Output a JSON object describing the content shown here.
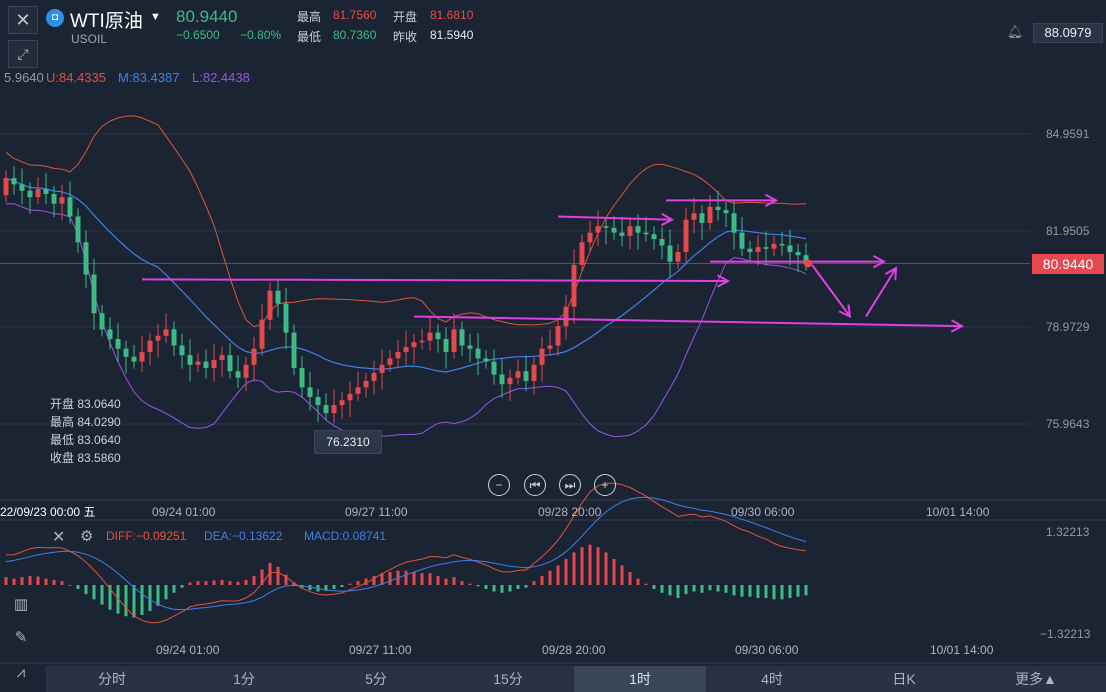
{
  "header": {
    "close_icon": "close-icon",
    "symbol_name": "WTI原油",
    "symbol_code": "USOIL",
    "last_price": "80.9440",
    "change": "−0.6500",
    "change_pct": "−0.80%",
    "high_label": "最高",
    "high_value": "81.7560",
    "open_label": "开盘",
    "open_value": "81.6810",
    "low_label": "最低",
    "low_value": "80.7360",
    "prev_close_label": "昨收",
    "prev_close_value": "81.5940",
    "alert_value": "88.0979"
  },
  "indicators": {
    "bb_cut": "5.9640",
    "bb_u": "U:84.4335",
    "bb_m": "M:83.4387",
    "bb_l": "L:82.4438",
    "macd_diff": "DIFF:−0.09251",
    "macd_dea": "DEA:−0.13622",
    "macd_macd": "MACD:0.08741"
  },
  "ohlc_box": {
    "open": "开盘 83.0640",
    "high": "最高 84.0290",
    "low": "最低 83.0640",
    "close": "收盘 83.5860"
  },
  "price_axis": [
    "84.9591",
    "81.9505",
    "78.9729",
    "75.9643"
  ],
  "current_price_tag": "80.9440",
  "low_marker": "76.2310",
  "start_time": "22/09/23 00:00 五",
  "time_axis_main": [
    "09/24 01:00",
    "09/27 11:00",
    "09/28 20:00",
    "09/30 06:00",
    "10/01 14:00"
  ],
  "time_axis_macd": [
    "09/24 01:00",
    "09/27 11:00",
    "09/28 20:00",
    "09/30 06:00",
    "10/01 14:00"
  ],
  "macd_axis": [
    "1.32213",
    "−1.32213"
  ],
  "tabs": [
    "分时",
    "1分",
    "5分",
    "15分",
    "1时",
    "4时",
    "日K",
    "更多▲"
  ],
  "active_tab": "1时",
  "colors": {
    "up": "#e5484d",
    "down": "#3dbb86",
    "bb_upper": "#e0533f",
    "bb_mid": "#3f7fe8",
    "bb_lower": "#9a55e0",
    "annotation": "#e23fe0",
    "background": "#1b2433"
  },
  "chart_data": [
    {
      "type": "candlestick",
      "title": "WTI原油 USOIL 1时",
      "indicator": "Bollinger Bands",
      "ylim": [
        74.5,
        88.0
      ],
      "y_ticks": [
        84.9591,
        81.9505,
        78.9729,
        75.9643
      ],
      "x_ticks": [
        "09/24 01:00",
        "09/27 11:00",
        "09/28 20:00",
        "09/30 06:00",
        "10/01 14:00"
      ],
      "last_price": 80.944,
      "marked_low": 76.231,
      "close_series": [
        83.59,
        83.4,
        83.2,
        83.0,
        83.25,
        83.1,
        82.8,
        83.0,
        82.4,
        81.6,
        80.6,
        79.4,
        78.9,
        78.6,
        78.3,
        78.05,
        77.9,
        78.2,
        78.55,
        78.7,
        78.9,
        78.4,
        78.1,
        77.8,
        77.9,
        77.7,
        77.95,
        78.1,
        77.6,
        77.4,
        77.8,
        78.3,
        79.2,
        80.1,
        79.7,
        78.8,
        77.7,
        77.1,
        76.8,
        76.55,
        76.3,
        76.55,
        76.7,
        76.9,
        77.1,
        77.3,
        77.55,
        77.8,
        78.0,
        78.2,
        78.35,
        78.5,
        78.55,
        78.8,
        78.6,
        78.2,
        78.9,
        78.4,
        78.3,
        78.0,
        77.9,
        77.5,
        77.2,
        77.4,
        77.6,
        77.3,
        77.8,
        78.3,
        78.4,
        79.0,
        79.6,
        80.9,
        81.6,
        81.9,
        82.1,
        82.05,
        81.9,
        81.8,
        82.1,
        81.9,
        81.85,
        81.7,
        81.5,
        81.0,
        81.3,
        82.3,
        82.5,
        82.2,
        82.7,
        82.6,
        82.5,
        81.9,
        81.4,
        81.3,
        81.45,
        81.4,
        81.55,
        81.5,
        81.3,
        81.2,
        80.94
      ]
    },
    {
      "type": "bar",
      "title": "MACD",
      "series": [
        {
          "name": "DIFF",
          "last": -0.09251
        },
        {
          "name": "DEA",
          "last": -0.13622
        },
        {
          "name": "MACD",
          "last": 0.08741
        }
      ],
      "ylim": [
        -1.32213,
        1.32213
      ],
      "histogram": [
        0.12,
        0.1,
        0.12,
        0.14,
        0.13,
        0.1,
        0.08,
        0.06,
        0.0,
        -0.06,
        -0.14,
        -0.22,
        -0.3,
        -0.38,
        -0.44,
        -0.48,
        -0.5,
        -0.46,
        -0.4,
        -0.32,
        -0.22,
        -0.12,
        -0.04,
        0.04,
        0.06,
        0.06,
        0.07,
        0.08,
        0.06,
        0.05,
        0.08,
        0.14,
        0.24,
        0.34,
        0.28,
        0.16,
        0.04,
        -0.04,
        -0.08,
        -0.1,
        -0.09,
        -0.06,
        -0.03,
        0.02,
        0.06,
        0.1,
        0.14,
        0.18,
        0.2,
        0.22,
        0.22,
        0.2,
        0.18,
        0.18,
        0.14,
        0.1,
        0.12,
        0.06,
        0.02,
        -0.02,
        -0.06,
        -0.1,
        -0.12,
        -0.1,
        -0.06,
        -0.04,
        0.06,
        0.14,
        0.22,
        0.3,
        0.4,
        0.5,
        0.58,
        0.62,
        0.58,
        0.5,
        0.4,
        0.3,
        0.2,
        0.1,
        0.02,
        -0.06,
        -0.12,
        -0.16,
        -0.2,
        -0.14,
        -0.1,
        -0.12,
        -0.08,
        -0.1,
        -0.12,
        -0.16,
        -0.18,
        -0.18,
        -0.2,
        -0.2,
        -0.22,
        -0.22,
        -0.2,
        -0.18,
        -0.16
      ]
    }
  ]
}
